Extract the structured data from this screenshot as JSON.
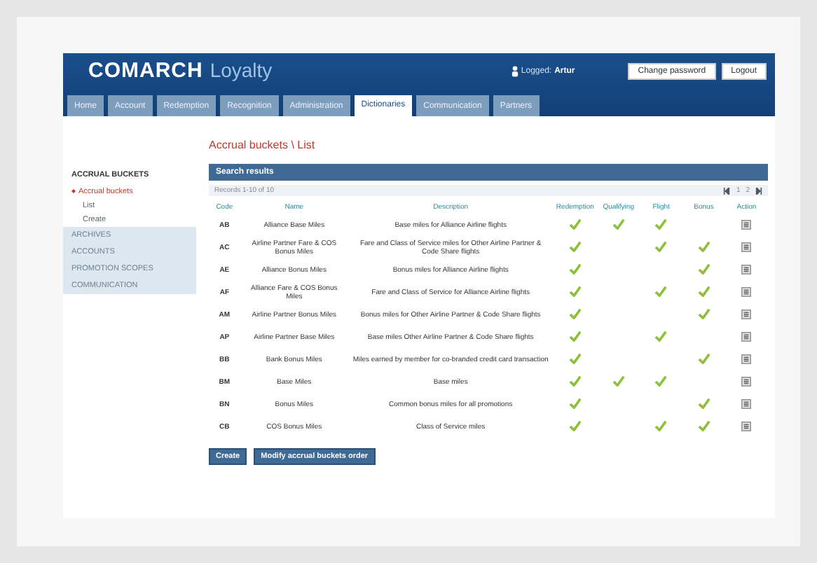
{
  "header": {
    "logo_main": "COMARCH",
    "logo_sub": "Loyalty",
    "user_label": "Logged:",
    "user_name": "Artur",
    "buttons": [
      "Change password",
      "Logout"
    ]
  },
  "tabs": [
    {
      "label": "Home",
      "selected": false
    },
    {
      "label": "Account",
      "selected": false
    },
    {
      "label": "Redemption",
      "selected": false
    },
    {
      "label": "Recognition",
      "selected": false
    },
    {
      "label": "Administration",
      "selected": false
    },
    {
      "label": "Dictionaries",
      "selected": true
    },
    {
      "label": "Communication",
      "selected": false
    },
    {
      "label": "Partners",
      "selected": false
    }
  ],
  "sidebar": {
    "items": [
      {
        "label": "ACCRUAL BUCKETS",
        "kind": "heading",
        "selected": false,
        "children": [
          {
            "label": "Accrual buckets",
            "selected": true,
            "children": [
              {
                "label": "List",
                "selected": false
              },
              {
                "label": "Create",
                "selected": false
              }
            ]
          }
        ]
      },
      {
        "label": "ARCHIVES",
        "kind": "section",
        "selected": false
      },
      {
        "label": "ACCOUNTS",
        "kind": "section",
        "selected": false
      },
      {
        "label": "PROMOTION SCOPES",
        "kind": "section",
        "selected": false
      },
      {
        "label": "COMMUNICATION",
        "kind": "section",
        "selected": false
      }
    ]
  },
  "page_title": "Accrual buckets \\ List",
  "results": {
    "title": "Search results",
    "summary": "Records 1-10 of 10",
    "pager": [
      "1",
      "2"
    ],
    "columns": [
      "Code",
      "Name",
      "Description",
      "Redemption",
      "Qualifying",
      "Flight",
      "Bonus",
      "Action"
    ],
    "rows": [
      {
        "code": "AB",
        "name": "Alliance Base Miles",
        "description": "Base miles for Alliance Airline flights",
        "redemption": true,
        "qualifying": true,
        "flight": true,
        "bonus": false
      },
      {
        "code": "AC",
        "name": "Airline Partner Fare & COS Bonus Miles",
        "description": "Fare and Class of Service miles for Other Airline Partner & Code Share flights",
        "redemption": true,
        "qualifying": false,
        "flight": true,
        "bonus": true
      },
      {
        "code": "AE",
        "name": "Alliance Bonus Miles",
        "description": "Bonus miles for Alliance Airline flights",
        "redemption": true,
        "qualifying": false,
        "flight": false,
        "bonus": true
      },
      {
        "code": "AF",
        "name": "Alliance Fare & COS Bonus Miles",
        "description": "Fare and Class of Service for Alliance Airline flights",
        "redemption": true,
        "qualifying": false,
        "flight": true,
        "bonus": true
      },
      {
        "code": "AM",
        "name": "Airline Partner Bonus Miles",
        "description": "Bonus miles for Other Airline Partner & Code Share flights",
        "redemption": true,
        "qualifying": false,
        "flight": false,
        "bonus": true
      },
      {
        "code": "AP",
        "name": "Airline Partner Base Miles",
        "description": "Base miles Other Airline Partner & Code Share flights",
        "redemption": true,
        "qualifying": false,
        "flight": true,
        "bonus": false
      },
      {
        "code": "BB",
        "name": "Bank Bonus Miles",
        "description": "Miles earned by member for co-branded credit card transaction",
        "redemption": true,
        "qualifying": false,
        "flight": false,
        "bonus": true
      },
      {
        "code": "BM",
        "name": "Base Miles",
        "description": "Base miles",
        "redemption": true,
        "qualifying": true,
        "flight": true,
        "bonus": false
      },
      {
        "code": "BN",
        "name": "Bonus Miles",
        "description": "Common bonus miles for all promotions",
        "redemption": true,
        "qualifying": false,
        "flight": false,
        "bonus": true
      },
      {
        "code": "CB",
        "name": "COS Bonus Miles",
        "description": "Class of Service miles",
        "redemption": true,
        "qualifying": false,
        "flight": true,
        "bonus": true
      }
    ],
    "buttons": [
      "Create",
      "Modify accrual buckets order"
    ]
  }
}
